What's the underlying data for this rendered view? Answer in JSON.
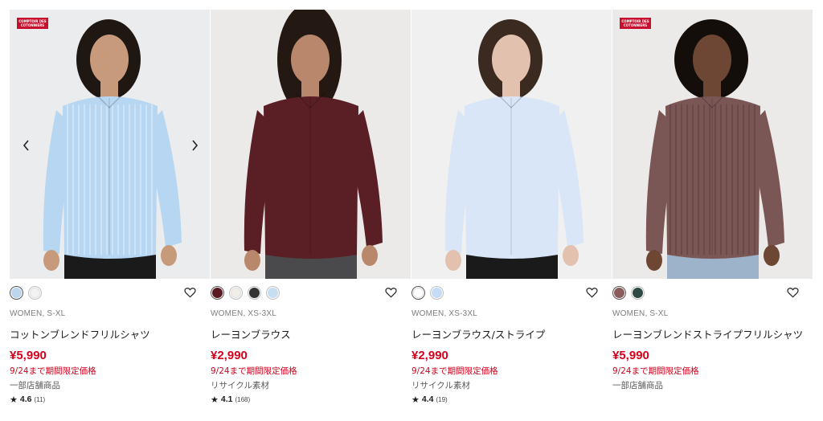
{
  "products": [
    {
      "badge": "COMPTOIR DES COTONNIERS",
      "has_arrows": true,
      "size_line": "WOMEN, S-XL",
      "name": "コットンブレンドフリルシャツ",
      "price": "¥5,990",
      "promo": "9/24まで期間限定価格",
      "note": "一部店舗商品",
      "rating": "4.6",
      "review_count": "(11)",
      "swatches": [
        "#bcd6ee",
        "#f2f2f2"
      ],
      "bg": "#ebecee",
      "shirt_color": "#b7d6f2",
      "skin": "#c79a7b",
      "hair": "#1f1712",
      "pants": "#1a1a1a"
    },
    {
      "badge": "",
      "has_arrows": false,
      "size_line": "WOMEN, XS-3XL",
      "name": "レーヨンブラウス",
      "price": "¥2,990",
      "promo": "9/24まで期間限定価格",
      "note": "リサイクル素材",
      "rating": "4.1",
      "review_count": "(168)",
      "swatches": [
        "#5b1a22",
        "#f1eeea",
        "#333333",
        "#c7ddf2"
      ],
      "bg": "#eceae8",
      "shirt_color": "#5a1f25",
      "skin": "#b9876c",
      "hair": "#241812",
      "pants": "#4a4a4c"
    },
    {
      "badge": "",
      "has_arrows": false,
      "size_line": "WOMEN, XS-3XL",
      "name": "レーヨンブラウス/ストライプ",
      "price": "¥2,990",
      "promo": "9/24まで期間限定価格",
      "note": "リサイクル素材",
      "rating": "4.4",
      "review_count": "(19)",
      "swatches": [
        "#ffffff",
        "#c5dcf3"
      ],
      "bg": "#f0f0f0",
      "shirt_color": "#d8e6f7",
      "skin": "#e2c2ae",
      "hair": "#3b2a20",
      "pants": "#1a1a1a"
    },
    {
      "badge": "COMPTOIR DES COTONNIERS",
      "has_arrows": false,
      "size_line": "WOMEN, S-XL",
      "name": "レーヨンブレンドストライプフリルシャツ",
      "price": "¥5,990",
      "promo": "9/24まで期間限定価格",
      "note": "一部店舗商品",
      "rating": "",
      "review_count": "",
      "swatches": [
        "#8a5c5c",
        "#2f4a44"
      ],
      "bg": "#eceae8",
      "shirt_color": "#7a5755",
      "skin": "#6e4634",
      "hair": "#140e0b",
      "pants": "#9cb3c9"
    }
  ],
  "icons": {
    "heart": "heart-icon",
    "star": "★",
    "left": "chevron-left-icon",
    "right": "chevron-right-icon"
  }
}
